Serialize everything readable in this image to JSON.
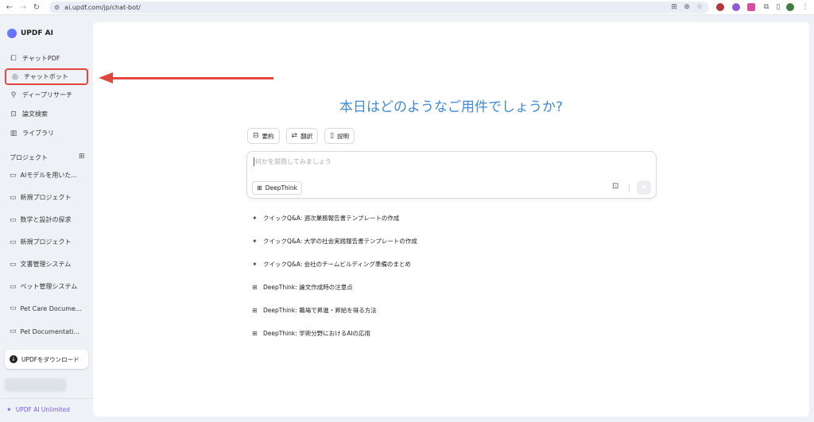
{
  "browser": {
    "url": "ai.updf.com/jp/chat-bot/",
    "back_icon": "arrow-left-icon",
    "forward_icon": "arrow-right-icon",
    "reload_icon": "reload-icon"
  },
  "brand": {
    "name": "UPDF AI"
  },
  "sidebar": {
    "items": [
      {
        "label": "チャットPDF",
        "icon": "pdf-chat-icon"
      },
      {
        "label": "チャットボット",
        "icon": "chatbot-icon"
      },
      {
        "label": "ディープリサーチ",
        "icon": "research-icon"
      },
      {
        "label": "論文検索",
        "icon": "paper-search-icon"
      },
      {
        "label": "ライブラリ",
        "icon": "library-icon"
      }
    ],
    "projects_label": "プロジェクト",
    "projects": [
      "AIモデルを用いた...",
      "新規プロジェクト",
      "数学と設計の探求",
      "新規プロジェクト",
      "文書管理システム",
      "ペット管理システム",
      "Pet Care Docume...",
      "Pet Documentati..."
    ],
    "download_label": "UPDFをダウンロード",
    "unlimited_label": "UPDF AI Unlimited"
  },
  "main": {
    "greeting": "本日はどのようなご用件でしょうか?",
    "chips": [
      "要約",
      "翻訳",
      "説明"
    ],
    "input_placeholder": "何かを質問してみましょう",
    "deepthink_label": "DeepThink",
    "suggestions": [
      {
        "text": "クイックQ&A: 週次業務報告書テンプレートの作成",
        "type": "quick"
      },
      {
        "text": "クイックQ&A: 大学の社会実践報告書テンプレートの作成",
        "type": "quick"
      },
      {
        "text": "クイックQ&A: 会社のチームビルディング準備のまとめ",
        "type": "quick"
      },
      {
        "text": "DeepThink: 論文作成時の注意点",
        "type": "deep"
      },
      {
        "text": "DeepThink: 職場で昇進・昇給を得る方法",
        "type": "deep"
      },
      {
        "text": "DeepThink: 学術分野におけるAIの応用",
        "type": "deep"
      }
    ]
  },
  "colors": {
    "accent": "#3d8bd8",
    "highlight": "#e3463f",
    "unlimited": "#7a5cf5"
  }
}
